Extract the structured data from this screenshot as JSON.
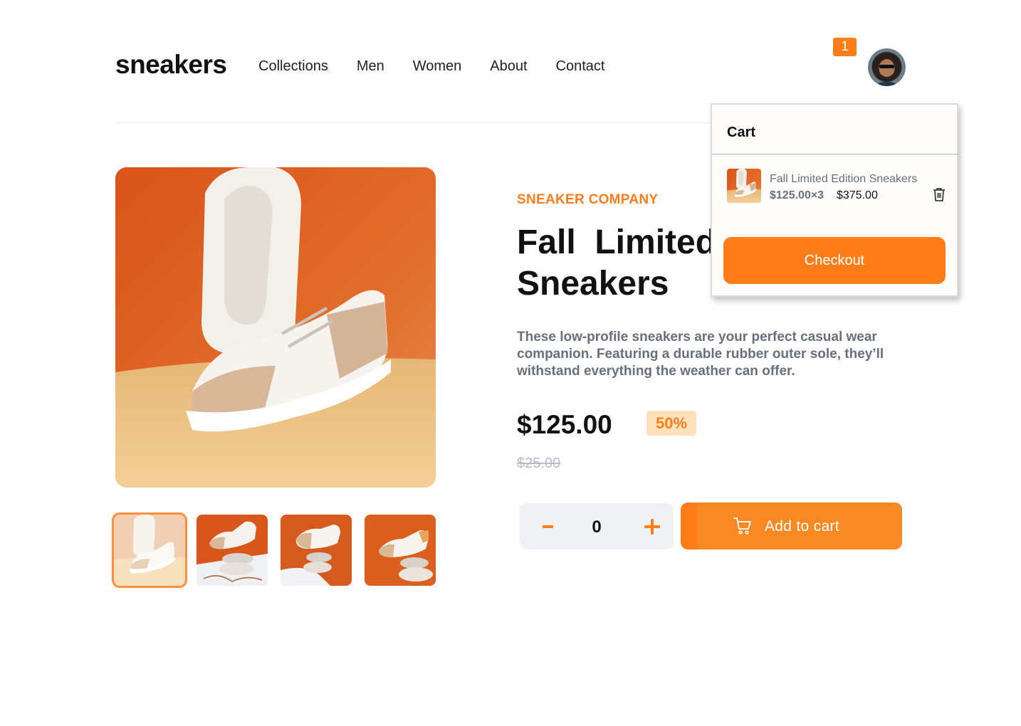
{
  "header": {
    "logo": "sneakers",
    "nav": [
      "Collections",
      "Men",
      "Women",
      "About",
      "Contact"
    ],
    "cart_count": "1"
  },
  "gallery": {
    "main_image": "sneaker-on-orange-background",
    "thumbnails": [
      "sneaker-thumbnail-1",
      "sneaker-thumbnail-2",
      "sneaker-thumbnail-3",
      "sneaker-thumbnail-4"
    ],
    "active_thumbnail": 1
  },
  "product": {
    "company": "SNEAKER COMPANY",
    "title_line1": "Fall  Limited",
    "title_line2": "Sneakers",
    "description": "These low-profile sneakers are your perfect casual wear companion. Featuring a durable rubber outer sole, they’ll withstand everything the weather can offer.",
    "price": "$125.00",
    "discount": "50%",
    "old_price": "$25.00",
    "quantity": "0",
    "add_to_cart_label": "Add to cart"
  },
  "cart": {
    "title": "Cart",
    "item_name": "Fall Limited Edition Sneakers",
    "item_unit": "$125.00×3",
    "item_total": "$375.00",
    "checkout_label": "Checkout"
  },
  "colors": {
    "accent": "#ff7e1b",
    "accent_light": "#ffe1bb",
    "text_dark": "#1d2026",
    "text_muted": "#68707d"
  }
}
